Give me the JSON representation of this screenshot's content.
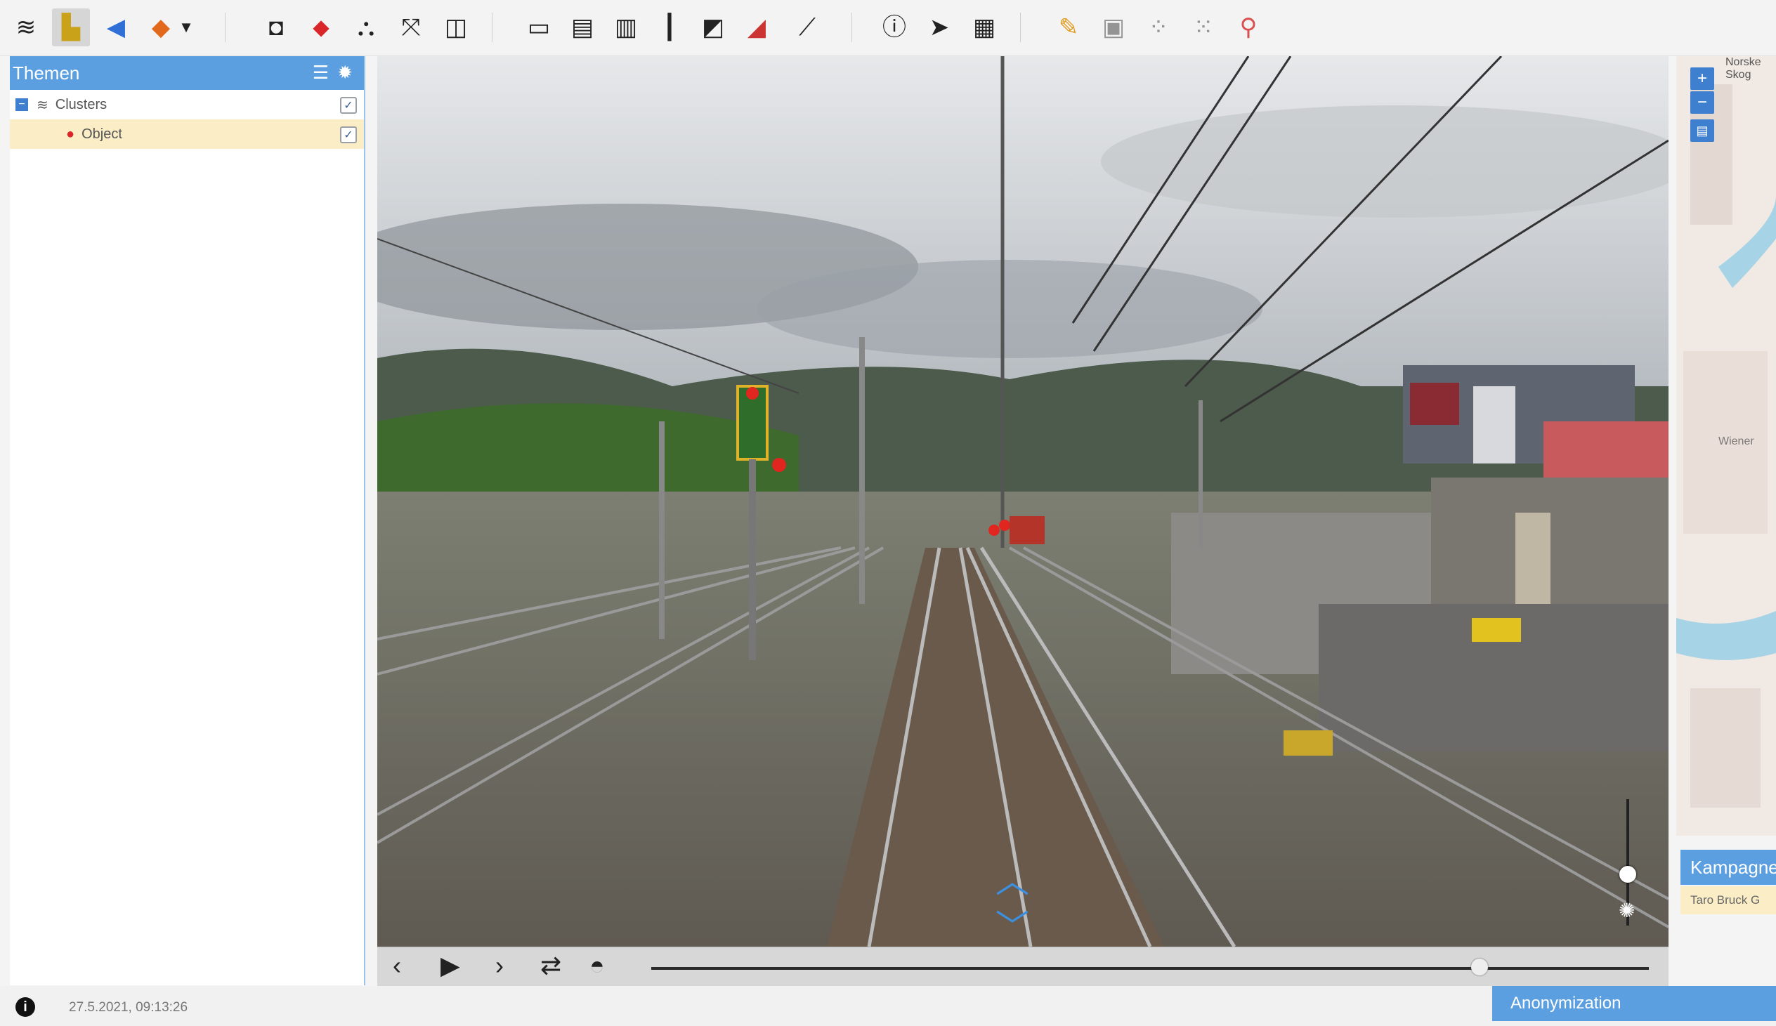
{
  "toolbar": {
    "icons": [
      "layers-icon",
      "chart-icon",
      "back-arrow-icon",
      "poi-icon",
      "dropdown-caret-icon",
      "camera-icon",
      "pin-select-icon",
      "cluster-icon",
      "fit-extent-icon",
      "split-view-icon",
      "measure-width-icon",
      "measure-height-icon",
      "measure-area-icon",
      "measure-vertical-icon",
      "profile-icon",
      "gradient-icon",
      "edit-line-icon",
      "info-icon",
      "pointer-icon",
      "table-icon",
      "pencil-icon",
      "save-icon",
      "vertex-icon",
      "scatter-icon",
      "search-select-icon"
    ]
  },
  "panel": {
    "title": "Themen",
    "tree": [
      {
        "label": "Clusters",
        "checked": true
      },
      {
        "label": "Object",
        "checked": true
      }
    ]
  },
  "viewer": {
    "nav_up_icon": "chevron-up-icon",
    "nav_down_icon": "chevron-down-icon",
    "brightness_level": 0.5
  },
  "controls": {
    "timeline_position": 0.83
  },
  "map": {
    "zoom_in": "+",
    "zoom_out": "−",
    "label_top": "Norske Skog",
    "label_mid": "Wiener"
  },
  "campaign": {
    "title": "Kampagne",
    "item": "Taro Bruck G"
  },
  "status": {
    "timestamp": "27.5.2021, 09:13:26",
    "anonymization_label": "Anonymization"
  },
  "colors": {
    "accent": "#5b9fe0",
    "selection": "#fbeec6"
  }
}
